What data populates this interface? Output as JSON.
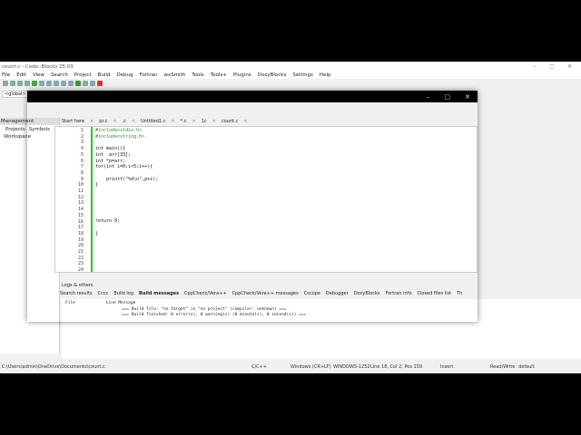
{
  "app": {
    "title": "count.c - Code::Blocks 25.03",
    "controls": [
      "–",
      "▢",
      "✕"
    ]
  },
  "menu": [
    "File",
    "Edit",
    "View",
    "Search",
    "Project",
    "Build",
    "Debug",
    "Fortran",
    "wxSmith",
    "Tools",
    "Tools+",
    "Plugins",
    "DoxyBlocks",
    "Settings",
    "Help"
  ],
  "scope": "<global>",
  "management": {
    "title": "Management",
    "tabs": [
      "Projects",
      "Symbols"
    ],
    "workspace": "Workspace"
  },
  "editor_tabs": [
    "Start here",
    "pr.c",
    ".c",
    "Untitled1.c",
    "*.c",
    "1c",
    "count.c"
  ],
  "code_lines": [
    "#include<stdio.h>",
    "#include<string.h>",
    "",
    "int main(){",
    "int  arr[33];",
    "int *p=arr;",
    "for(int i=0;i<5;i++){",
    "",
    "    printf(\"%d\\n\",p+i);",
    "}",
    "",
    "",
    "",
    "",
    "",
    "return 0;",
    "",
    "}",
    "",
    "",
    "",
    "",
    "",
    ""
  ],
  "logs": {
    "title": "Logs & others",
    "tabs": [
      "Search results",
      "Cccc",
      "Build log",
      "Build messages",
      "CppCheck/Vera++",
      "CppCheck/Vera++ messages",
      "Cscope",
      "Debugger",
      "DoxyBlocks",
      "Fortran info",
      "Closed files list",
      "Th"
    ],
    "columns": [
      "File",
      "Line",
      "Message"
    ],
    "messages": [
      "=== Build file: \"no target\" in \"no project\" (compiler: unknown) ===",
      "=== Build finished: 0 error(s), 0 warning(s) (0 minute(s), 0 second(s)) ==="
    ]
  },
  "status": {
    "path": "C:\\Users\\admin\\OneDrive\\Documents\\count.c",
    "lang": "C/C++",
    "eol": "Windows (CR+LF)",
    "encoding": "WINDOWS-1252",
    "position": "Line 18, Col 2, Pos 159",
    "mode": "Insert",
    "rw": "Read/Write",
    "profile": "default"
  }
}
